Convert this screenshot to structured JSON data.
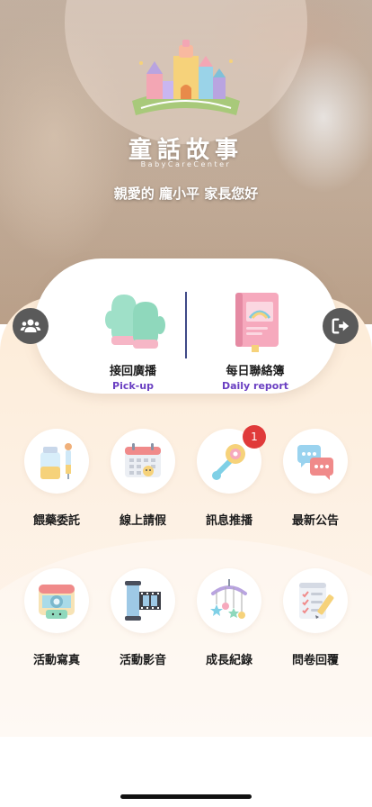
{
  "header": {
    "brand_title": "童話故事",
    "brand_subtitle": "BabyCareCenter",
    "greeting": "親愛的 龐小平 家長您好"
  },
  "card": {
    "left": {
      "label": "接回廣播",
      "sub": "Pick-up",
      "icon": "mittens-icon"
    },
    "right": {
      "label": "每日聯絡簿",
      "sub": "Daily report",
      "icon": "notebook-icon"
    }
  },
  "side_buttons": {
    "left_icon": "users-icon",
    "right_icon": "logout-icon"
  },
  "grid": [
    {
      "label": "餵藥委託",
      "icon": "medicine-icon"
    },
    {
      "label": "線上請假",
      "icon": "calendar-icon"
    },
    {
      "label": "訊息推播",
      "icon": "rattle-icon",
      "badge": "1"
    },
    {
      "label": "最新公告",
      "icon": "chat-bubbles-icon"
    },
    {
      "label": "活動寫真",
      "icon": "camera-icon"
    },
    {
      "label": "活動影音",
      "icon": "film-icon"
    },
    {
      "label": "成長紀錄",
      "icon": "baby-mobile-icon"
    },
    {
      "label": "問卷回覆",
      "icon": "checklist-icon"
    }
  ],
  "colors": {
    "accent_purple": "#6a3fc2",
    "divider_navy": "#3f4a87",
    "badge_red": "#e03a3a",
    "side_button": "#5a5a5a"
  }
}
